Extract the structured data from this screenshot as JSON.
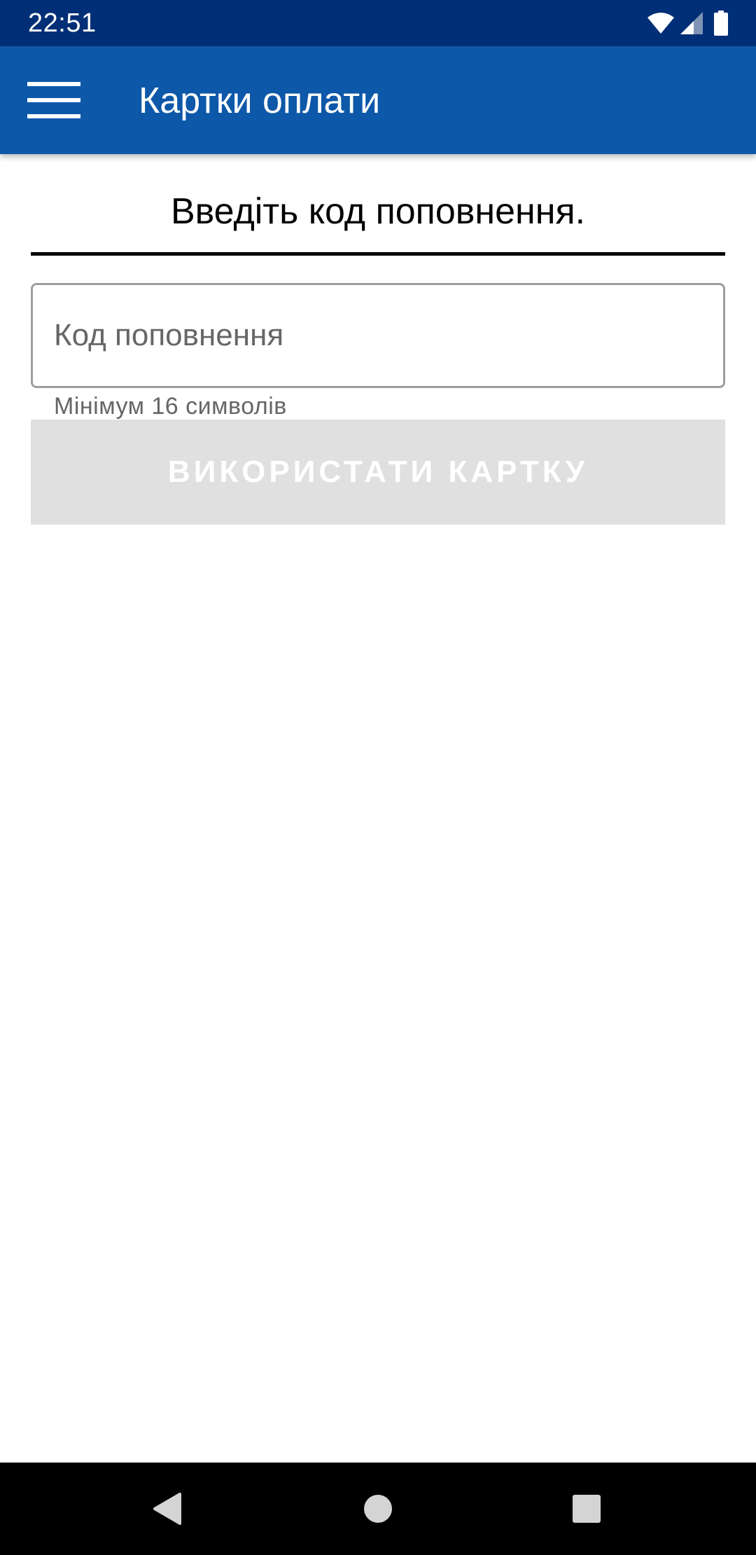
{
  "status_bar": {
    "time": "22:51",
    "icons": [
      "wifi-icon",
      "cell-signal-icon",
      "battery-icon"
    ]
  },
  "app_bar": {
    "title": "Картки оплати",
    "menu_icon": "hamburger-menu-icon",
    "background_color": "#0d58a8"
  },
  "form": {
    "instruction": "Введіть код поповнення.",
    "code_input": {
      "value": "",
      "placeholder": "Код поповнення"
    },
    "helper_text": "Мінімум 16 символів",
    "use_card_button_label": "ВИКОРИСТАТИ КАРТКУ"
  },
  "nav_bar": {
    "buttons": [
      "back-icon",
      "home-icon",
      "recents-icon"
    ]
  },
  "colors": {
    "status_bar": "#002f77",
    "app_bar": "#0d58a8",
    "button_disabled_bg": "#e0e0e0",
    "button_disabled_text": "#ffffff"
  }
}
